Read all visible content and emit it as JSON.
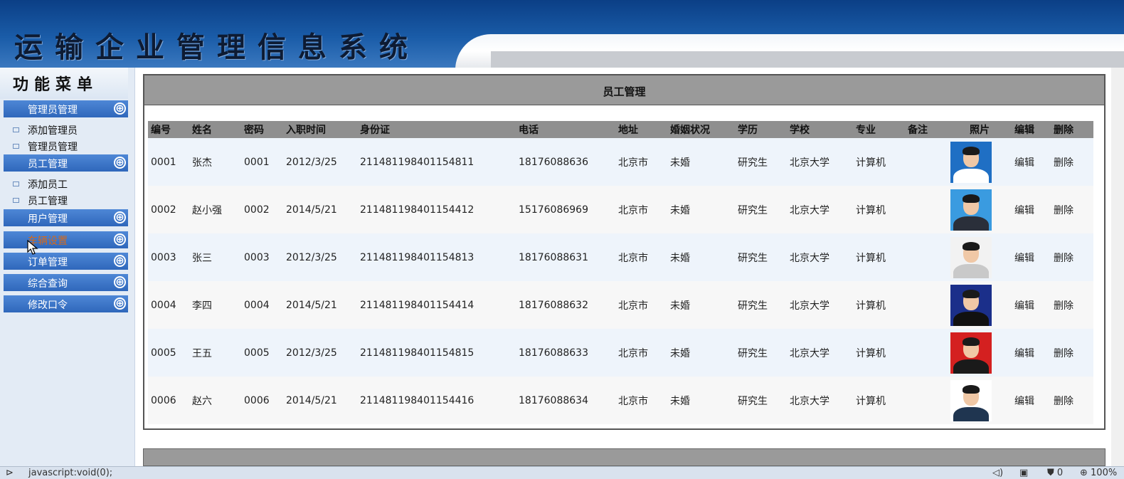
{
  "banner": {
    "title": "运输企业管理信息系统"
  },
  "sidebar": {
    "header": "功能菜单",
    "groups": [
      {
        "label": "管理员管理",
        "items": [
          "添加管理员",
          "管理员管理"
        ]
      },
      {
        "label": "员工管理",
        "items": [
          "添加员工",
          "员工管理"
        ]
      },
      {
        "label": "用户管理",
        "items": []
      },
      {
        "label": "车辆设置",
        "items": []
      },
      {
        "label": "订单管理",
        "items": []
      },
      {
        "label": "综合查询",
        "items": []
      },
      {
        "label": "修改口令",
        "items": []
      }
    ],
    "expand_icon": "⊕"
  },
  "main": {
    "title": "员工管理",
    "columns": [
      "编号",
      "姓名",
      "密码",
      "入职时间",
      "身份证",
      "电话",
      "地址",
      "婚姻状况",
      "学历",
      "学校",
      "专业",
      "备注",
      "照片",
      "编辑",
      "删除"
    ],
    "rows": [
      {
        "id": "0001",
        "name": "张杰",
        "password": "0001",
        "hire_date": "2012/3/25",
        "id_card": "211481198401154811",
        "phone": "18176088636",
        "address": "北京市",
        "marital": "未婚",
        "education": "研究生",
        "school": "北京大学",
        "major": "计算机",
        "note": "",
        "edit": "编辑",
        "delete": "删除",
        "photo_bg": "#1f6fc4",
        "photo_body": "#ffffff"
      },
      {
        "id": "0002",
        "name": "赵小强",
        "password": "0002",
        "hire_date": "2014/5/21",
        "id_card": "211481198401154412",
        "phone": "15176086969",
        "address": "北京市",
        "marital": "未婚",
        "education": "研究生",
        "school": "北京大学",
        "major": "计算机",
        "note": "",
        "edit": "编辑",
        "delete": "删除",
        "photo_bg": "#3a9be0",
        "photo_body": "#2a2f3a"
      },
      {
        "id": "0003",
        "name": "张三",
        "password": "0003",
        "hire_date": "2012/3/25",
        "id_card": "211481198401154813",
        "phone": "18176088631",
        "address": "北京市",
        "marital": "未婚",
        "education": "研究生",
        "school": "北京大学",
        "major": "计算机",
        "note": "",
        "edit": "编辑",
        "delete": "删除",
        "photo_bg": "#f2f2f2",
        "photo_body": "#c9c9c9"
      },
      {
        "id": "0004",
        "name": "李四",
        "password": "0004",
        "hire_date": "2014/5/21",
        "id_card": "211481198401154414",
        "phone": "18176088632",
        "address": "北京市",
        "marital": "未婚",
        "education": "研究生",
        "school": "北京大学",
        "major": "计算机",
        "note": "",
        "edit": "编辑",
        "delete": "删除",
        "photo_bg": "#1b2f8a",
        "photo_body": "#111111"
      },
      {
        "id": "0005",
        "name": "王五",
        "password": "0005",
        "hire_date": "2012/3/25",
        "id_card": "211481198401154815",
        "phone": "18176088633",
        "address": "北京市",
        "marital": "未婚",
        "education": "研究生",
        "school": "北京大学",
        "major": "计算机",
        "note": "",
        "edit": "编辑",
        "delete": "删除",
        "photo_bg": "#d42020",
        "photo_body": "#1a1a1a"
      },
      {
        "id": "0006",
        "name": "赵六",
        "password": "0006",
        "hire_date": "2014/5/21",
        "id_card": "211481198401154416",
        "phone": "18176088634",
        "address": "北京市",
        "marital": "未婚",
        "education": "研究生",
        "school": "北京大学",
        "major": "计算机",
        "note": "",
        "edit": "编辑",
        "delete": "删除",
        "photo_bg": "#ffffff",
        "photo_body": "#1f3550"
      }
    ]
  },
  "statusbar": {
    "text": "javascript:void(0);",
    "icons": [
      "forward-icon",
      "speaker-icon",
      "display-icon",
      "shield-icon",
      "zoom-icon"
    ],
    "count": "0",
    "zoom": "100%"
  }
}
